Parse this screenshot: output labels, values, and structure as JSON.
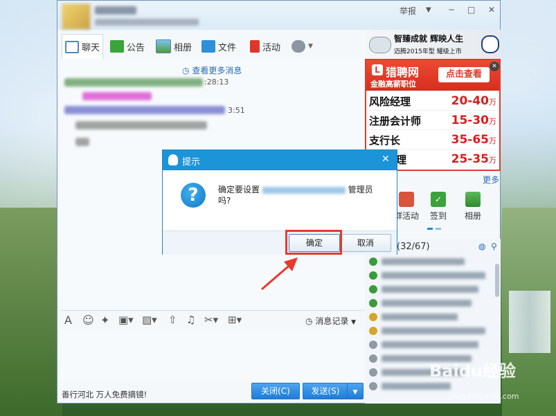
{
  "window": {
    "controls": {
      "report": "举报",
      "minimize": "−",
      "maximize": "□",
      "close": "✕"
    }
  },
  "toolbar": {
    "chat": "聊天",
    "notice": "公告",
    "album": "相册",
    "files": "文件",
    "activity": "活动"
  },
  "chat": {
    "more_messages": "查看更多消息",
    "time1": ":28:13",
    "time2": "3:51"
  },
  "input": {
    "history": "消息记录"
  },
  "footer": {
    "ad_text": "善行河北 万人免费摘镜!",
    "close_button": "关闭(C)",
    "send_button": "发送(S)"
  },
  "ad": {
    "vw_line1": "智臻成就 辉映人生",
    "vw_line2": "迈腾2015年型 耀级上市",
    "brand": "猎聘网",
    "tagline": "金融高薪职位",
    "cta": "点击查看",
    "jobs": [
      {
        "name": "风险经理",
        "salary": "20-40",
        "unit": "万"
      },
      {
        "name": "注册会计师",
        "salary": "15-30",
        "unit": "万"
      },
      {
        "name": "支行长",
        "salary": "35-65",
        "unit": "万"
      },
      {
        "name": "管理",
        "salary": "25-35",
        "unit": "万"
      }
    ]
  },
  "apps": {
    "more": "更多",
    "items": [
      {
        "label": "群活动"
      },
      {
        "label": "签到"
      },
      {
        "label": "相册"
      }
    ]
  },
  "members": {
    "count": "(32/67)"
  },
  "dialog": {
    "title": "提示",
    "message_prefix": "确定要设置",
    "message_suffix": "管理员吗?",
    "ok": "确定",
    "cancel": "取消"
  },
  "watermark": {
    "main": "Baidu经验",
    "sub": "jingyan.baidu.com"
  },
  "colors": {
    "accent": "#1b94d8",
    "highlight": "#e8392d",
    "salary": "#d61f1f"
  }
}
